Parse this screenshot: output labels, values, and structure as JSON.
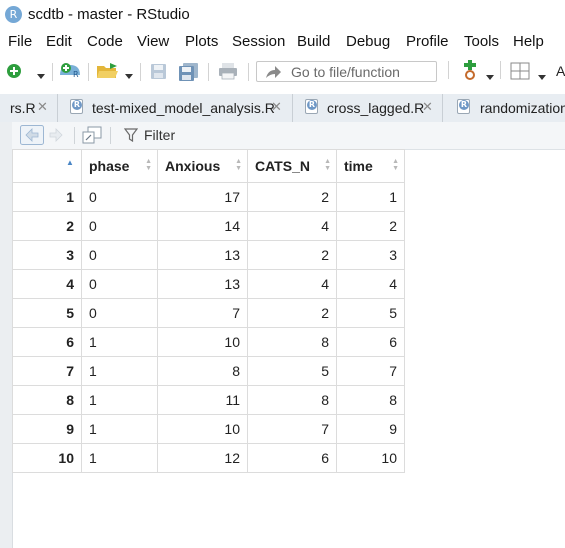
{
  "window": {
    "title": "scdtb - master - RStudio",
    "app_icon_letter": "R"
  },
  "menu": [
    "File",
    "Edit",
    "Code",
    "View",
    "Plots",
    "Session",
    "Build",
    "Debug",
    "Profile",
    "Tools",
    "Help"
  ],
  "toolbar": {
    "goto_placeholder": "Go to file/function",
    "addins_initial": "A"
  },
  "tabs": [
    {
      "label": "rs.R",
      "active": false
    },
    {
      "label": "test-mixed_model_analysis.R",
      "active": false
    },
    {
      "label": "cross_lagged.R",
      "active": false
    },
    {
      "label": "randomization",
      "active": false
    }
  ],
  "viewer": {
    "filter_label": "Filter"
  },
  "table": {
    "columns": [
      "phase",
      "Anxious",
      "CATS_N",
      "time"
    ],
    "rows": [
      {
        "n": "1",
        "phase": "0",
        "Anxious": "17",
        "CATS_N": "2",
        "time": "1"
      },
      {
        "n": "2",
        "phase": "0",
        "Anxious": "14",
        "CATS_N": "4",
        "time": "2"
      },
      {
        "n": "3",
        "phase": "0",
        "Anxious": "13",
        "CATS_N": "2",
        "time": "3"
      },
      {
        "n": "4",
        "phase": "0",
        "Anxious": "13",
        "CATS_N": "4",
        "time": "4"
      },
      {
        "n": "5",
        "phase": "0",
        "Anxious": "7",
        "CATS_N": "2",
        "time": "5"
      },
      {
        "n": "6",
        "phase": "1",
        "Anxious": "10",
        "CATS_N": "8",
        "time": "6"
      },
      {
        "n": "7",
        "phase": "1",
        "Anxious": "8",
        "CATS_N": "5",
        "time": "7"
      },
      {
        "n": "8",
        "phase": "1",
        "Anxious": "11",
        "CATS_N": "8",
        "time": "8"
      },
      {
        "n": "9",
        "phase": "1",
        "Anxious": "10",
        "CATS_N": "7",
        "time": "9"
      },
      {
        "n": "10",
        "phase": "1",
        "Anxious": "12",
        "CATS_N": "6",
        "time": "10"
      }
    ]
  },
  "colors": {
    "accent": "#4a86c5",
    "tab_strip": "#e8edf2",
    "green_add": "#2e9e3e"
  }
}
